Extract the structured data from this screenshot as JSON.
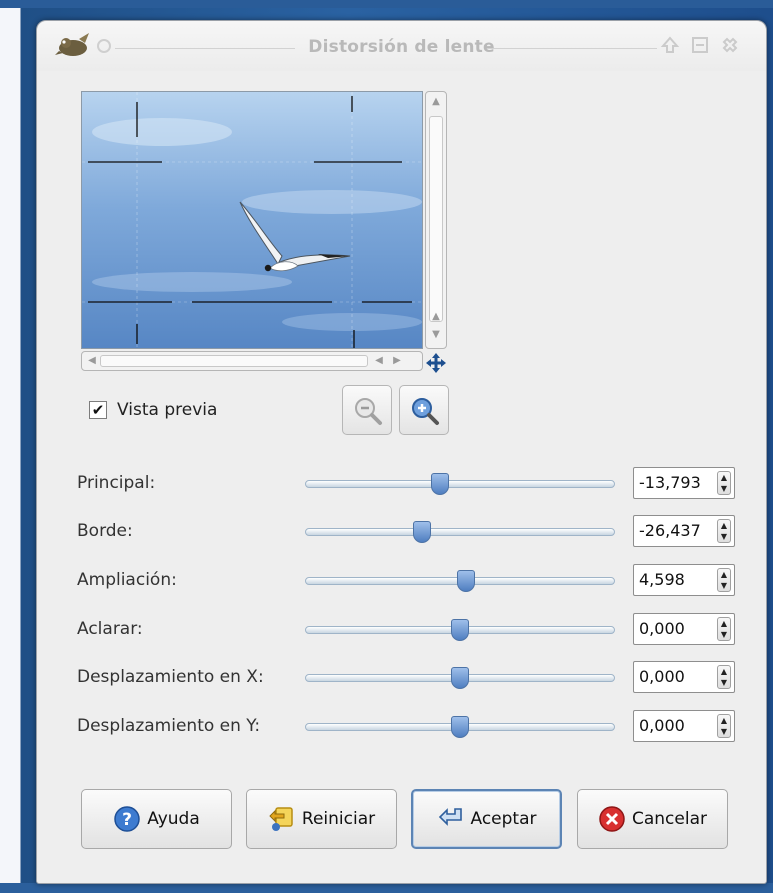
{
  "window": {
    "title": "Distorsión de lente"
  },
  "preview": {
    "checkbox_label": "Vista previa",
    "checked": true,
    "checkmark": "✔"
  },
  "parameters": [
    {
      "label": "Principal:",
      "value": "-13,793",
      "slider_fraction": 0.43
    },
    {
      "label": "Borde:",
      "value": "-26,437",
      "slider_fraction": 0.37
    },
    {
      "label": "Ampliación:",
      "value": "4,598",
      "slider_fraction": 0.52
    },
    {
      "label": "Aclarar:",
      "value": "0,000",
      "slider_fraction": 0.5
    },
    {
      "label": "Desplazamiento en X:",
      "value": "0,000",
      "slider_fraction": 0.5
    },
    {
      "label": "Desplazamiento en Y:",
      "value": "0,000",
      "slider_fraction": 0.5
    }
  ],
  "buttons": {
    "help": "Ayuda",
    "reset": "Reiniciar",
    "accept": "Aceptar",
    "cancel": "Cancelar"
  },
  "icons": {
    "app": "gimp-wilber-icon",
    "zoom_out": "zoom-out-icon",
    "zoom_in": "zoom-in-icon",
    "navigate": "navigate-move-icon",
    "help": "help-icon",
    "reset": "reset-icon",
    "accept": "accept-icon",
    "cancel": "cancel-icon"
  },
  "colors": {
    "slider_thumb": "#5b87c5",
    "sky": "#5d8fc9",
    "cancel_red": "#d62b2b",
    "help_blue": "#2d6fc4"
  }
}
